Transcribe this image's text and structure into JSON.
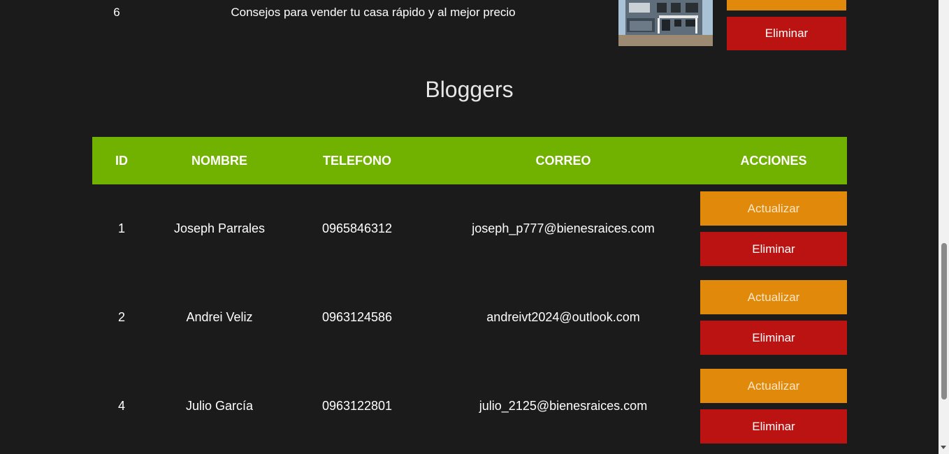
{
  "posts_table_tail": {
    "id": "6",
    "title": "Consejos para vender tu casa rápido y al mejor precio",
    "image_alt": "house-photo",
    "delete_label": "Eliminar"
  },
  "bloggers": {
    "title": "Bloggers",
    "headers": {
      "id": "ID",
      "nombre": "NOMBRE",
      "telefono": "TELEFONO",
      "correo": "CORREO",
      "acciones": "ACCIONES"
    },
    "rows": [
      {
        "id": "1",
        "nombre": "Joseph Parrales",
        "telefono": "0965846312",
        "correo": "joseph_p777@bienesraices.com",
        "update_label": "Actualizar",
        "delete_label": "Eliminar"
      },
      {
        "id": "2",
        "nombre": "Andrei Veliz",
        "telefono": "0963124586",
        "correo": "andreivt2024@outlook.com",
        "update_label": "Actualizar",
        "delete_label": "Eliminar"
      },
      {
        "id": "4",
        "nombre": "Julio García",
        "telefono": "0963122801",
        "correo": "julio_2125@bienesraices.com",
        "update_label": "Actualizar",
        "delete_label": "Eliminar"
      }
    ]
  },
  "colors": {
    "background": "#1b1b1b",
    "header_green": "#71b100",
    "update_orange": "#e0890b",
    "delete_red": "#bb1212"
  }
}
